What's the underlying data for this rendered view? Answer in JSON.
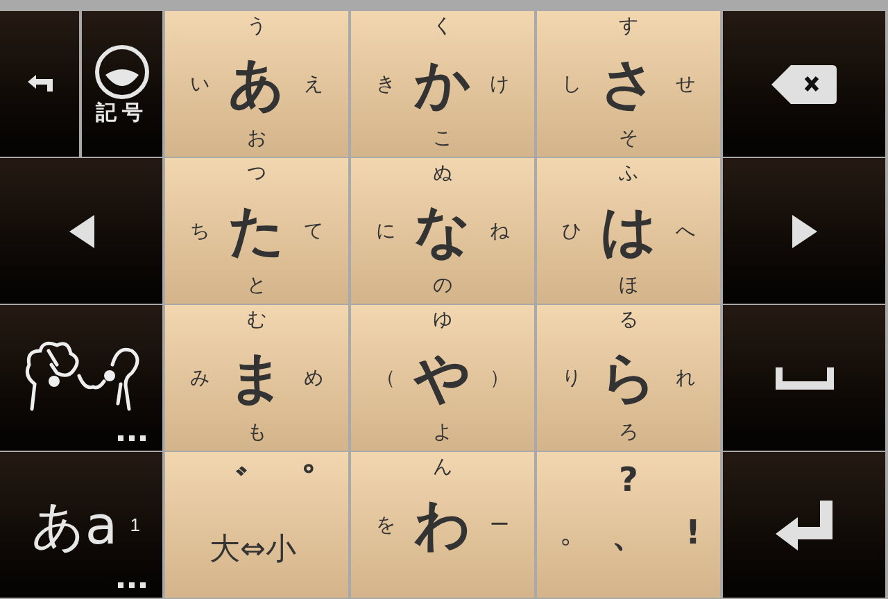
{
  "left_keys": [
    {
      "kind": "undo"
    },
    {
      "kind": "symbol",
      "label": "記号"
    },
    {
      "kind": "cursor_left"
    },
    {
      "kind": "emoticon"
    },
    {
      "kind": "mode",
      "label": "あa",
      "badge": "1"
    }
  ],
  "kana_keys": [
    {
      "kind": "kana",
      "top": "う",
      "left": "い",
      "center": "あ",
      "right": "え",
      "bottom": "お"
    },
    {
      "kind": "kana",
      "top": "く",
      "left": "き",
      "center": "か",
      "right": "け",
      "bottom": "こ"
    },
    {
      "kind": "kana",
      "top": "す",
      "left": "し",
      "center": "さ",
      "right": "せ",
      "bottom": "そ"
    },
    {
      "kind": "kana",
      "top": "つ",
      "left": "ち",
      "center": "た",
      "right": "て",
      "bottom": "と"
    },
    {
      "kind": "kana",
      "top": "ぬ",
      "left": "に",
      "center": "な",
      "right": "ね",
      "bottom": "の"
    },
    {
      "kind": "kana",
      "top": "ふ",
      "left": "ひ",
      "center": "は",
      "right": "へ",
      "bottom": "ほ"
    },
    {
      "kind": "kana",
      "top": "む",
      "left": "み",
      "center": "ま",
      "right": "め",
      "bottom": "も"
    },
    {
      "kind": "kana",
      "top": "ゆ",
      "left": "（",
      "center": "や",
      "right": "）",
      "bottom": "よ"
    },
    {
      "kind": "kana",
      "top": "る",
      "left": "り",
      "center": "ら",
      "right": "れ",
      "bottom": "ろ"
    },
    {
      "kind": "modifier",
      "marks": [
        "゛",
        "゜"
      ],
      "label": "大⇔小"
    },
    {
      "kind": "kana",
      "top": "ん",
      "left": "を",
      "center": "わ",
      "right": "ー"
    },
    {
      "kind": "punct",
      "top": "?",
      "left": "。",
      "center": "、",
      "right": "!"
    }
  ],
  "right_keys": [
    {
      "kind": "backspace"
    },
    {
      "kind": "cursor_right"
    },
    {
      "kind": "space"
    },
    {
      "kind": "enter"
    }
  ]
}
